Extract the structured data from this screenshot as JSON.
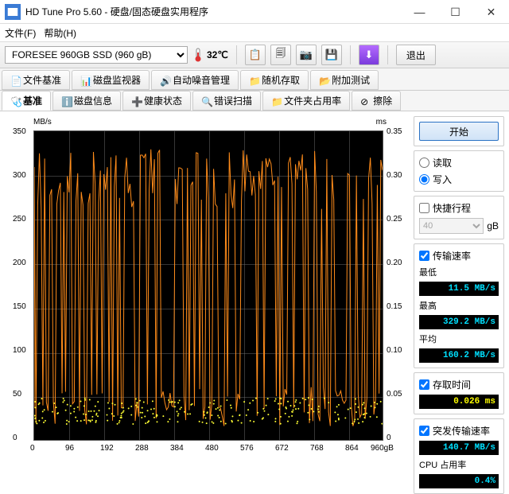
{
  "window": {
    "title": "HD Tune Pro 5.60 - 硬盘/固态硬盘实用程序",
    "minimize": "—",
    "maximize": "☐",
    "close": "✕"
  },
  "menu": {
    "file": "文件(F)",
    "help": "帮助(H)"
  },
  "toolbar": {
    "drive": "FORESEE 960GB SSD (960 gB)",
    "temp": "32℃",
    "exit": "退出"
  },
  "tabs_row1": [
    {
      "label": "文件基准",
      "icon": "📄"
    },
    {
      "label": "磁盘监视器",
      "icon": "📊"
    },
    {
      "label": "自动噪音管理",
      "icon": "🔊"
    },
    {
      "label": "随机存取",
      "icon": "📁"
    },
    {
      "label": "附加测试",
      "icon": "📂"
    }
  ],
  "tabs_row2": [
    {
      "label": "基准",
      "icon": "🩺",
      "active": true
    },
    {
      "label": "磁盘信息",
      "icon": "ℹ️"
    },
    {
      "label": "健康状态",
      "icon": "➕"
    },
    {
      "label": "错误扫描",
      "icon": "🔍"
    },
    {
      "label": "文件夹占用率",
      "icon": "📁"
    },
    {
      "label": "擦除",
      "icon": "⊘"
    }
  ],
  "chart": {
    "left_unit": "MB/s",
    "right_unit": "ms",
    "x_unit": "gB",
    "x_max": "960gB",
    "left_ticks": [
      "350",
      "300",
      "250",
      "200",
      "150",
      "100",
      "50",
      "0"
    ],
    "right_ticks": [
      "0.35",
      "0.30",
      "0.25",
      "0.20",
      "0.15",
      "0.10",
      "0.05",
      "0"
    ],
    "x_ticks": [
      "0",
      "96",
      "192",
      "288",
      "384",
      "480",
      "576",
      "672",
      "768",
      "864"
    ]
  },
  "side": {
    "start": "开始",
    "read": "读取",
    "write": "写入",
    "shortstroke": "快捷行程",
    "block_value": "40",
    "block_unit": "gB",
    "transfer_rate": "传输速率",
    "min_label": "最低",
    "min_value": "11.5 MB/s",
    "max_label": "最高",
    "max_value": "329.2 MB/s",
    "avg_label": "平均",
    "avg_value": "160.2 MB/s",
    "access_time": "存取时间",
    "access_value": "0.026 ms",
    "burst_rate": "突发传输速率",
    "burst_value": "140.7 MB/s",
    "cpu_label": "CPU 占用率",
    "cpu_value": "0.4%"
  },
  "chart_data": {
    "type": "line",
    "title": "",
    "xlabel": "gB",
    "series": [
      {
        "name": "Transfer rate (MB/s)",
        "axis": "left",
        "ylabel": "MB/s",
        "ylim": [
          0,
          350
        ],
        "x_range": [
          0,
          960
        ],
        "summary": {
          "min": 11.5,
          "max": 329.2,
          "avg": 160.2
        },
        "note": "dense oscillation between ~25 and ~330 MB/s across full range; ~200 spikes"
      },
      {
        "name": "Access time (ms)",
        "axis": "right",
        "ylabel": "ms",
        "ylim": [
          0,
          0.35
        ],
        "x_range": [
          0,
          960
        ],
        "summary": {
          "avg": 0.026
        },
        "note": "scatter band mostly 0.02–0.04 ms"
      }
    ],
    "x_ticks": [
      0,
      96,
      192,
      288,
      384,
      480,
      576,
      672,
      768,
      864,
      960
    ]
  }
}
